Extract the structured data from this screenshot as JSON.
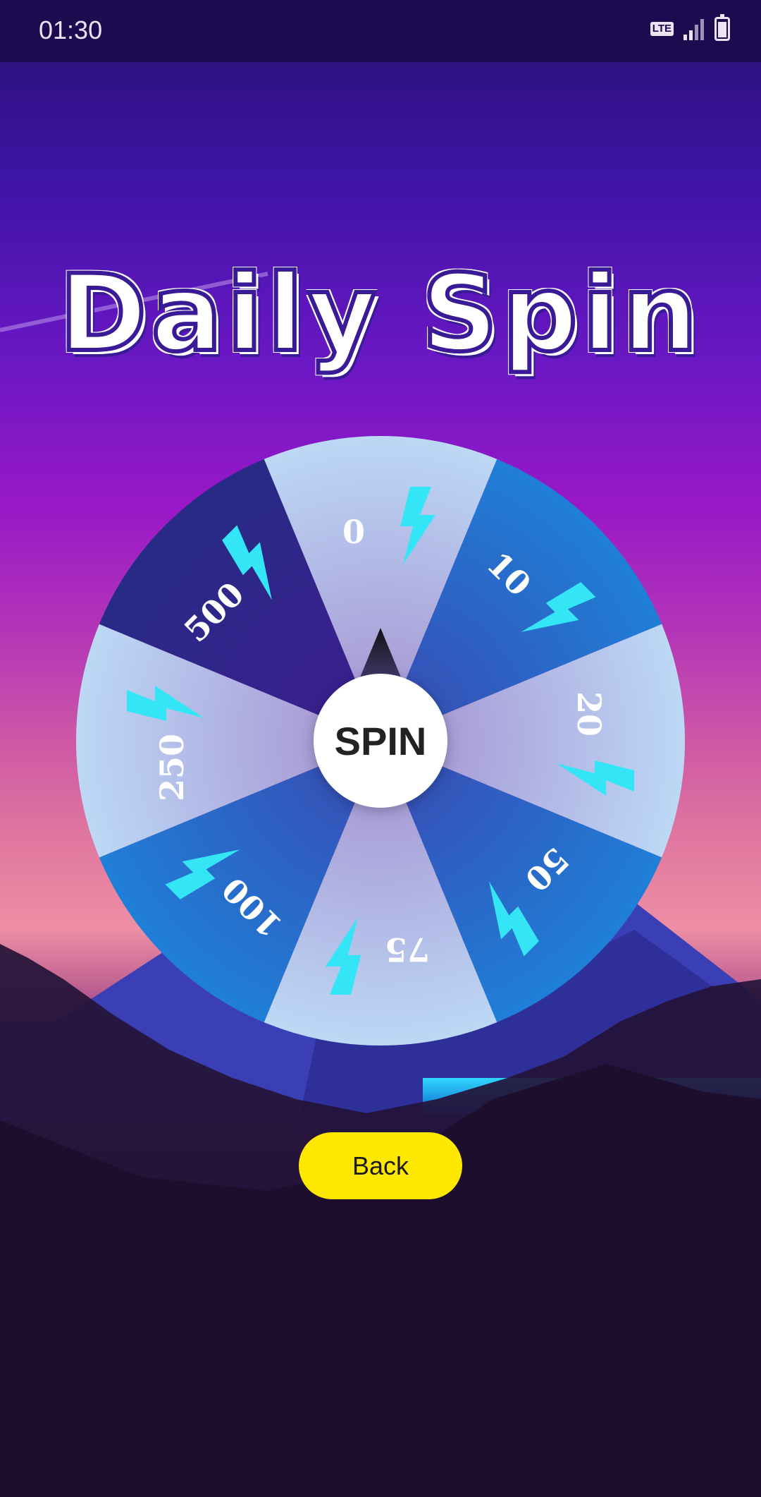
{
  "status_bar": {
    "time": "01:30",
    "network": "LTE"
  },
  "title": "Daily Spin",
  "wheel": {
    "segments": [
      {
        "value": "0",
        "colors": [
          "#bcd8f5",
          "#a99cd6"
        ]
      },
      {
        "value": "10",
        "colors": [
          "#1f7fd8",
          "#3552b8"
        ]
      },
      {
        "value": "20",
        "colors": [
          "#bcd8f5",
          "#a99cd6"
        ]
      },
      {
        "value": "50",
        "colors": [
          "#1f7fd8",
          "#3552b8"
        ]
      },
      {
        "value": "75",
        "colors": [
          "#bcd8f5",
          "#a99cd6"
        ]
      },
      {
        "value": "100",
        "colors": [
          "#1f7fd8",
          "#3552b8"
        ]
      },
      {
        "value": "250",
        "colors": [
          "#bcd8f5",
          "#a99cd6"
        ]
      },
      {
        "value": "500",
        "colors": [
          "#272b86",
          "#3a1f8e"
        ]
      }
    ],
    "spin_label": "SPIN",
    "icon": "lightning-bolt-icon",
    "accent_color": "#34e6f5"
  },
  "back_label": "Back"
}
